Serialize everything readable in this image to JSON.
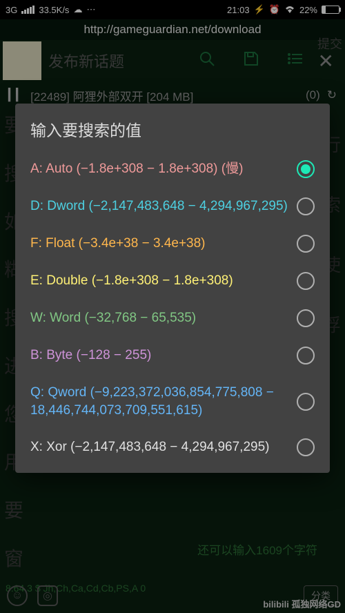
{
  "status": {
    "network": "3G",
    "speed": "33.5K/s",
    "time": "21:03",
    "battery_pct": "22%"
  },
  "url": "http://gameguardian.net/download",
  "bg": {
    "post_title": "发布新话题",
    "submit": "提交",
    "process_line": "[22489] 阿狸外部双开 [204 MB]",
    "process_count": "(0)",
    "left_words": [
      "要",
      "搜",
      "如",
      "糊",
      "搜",
      "进",
      "您",
      "用",
      "要",
      "窗"
    ],
    "right_words": [
      "行",
      "索",
      "使",
      "浮"
    ],
    "remaining": "还可以输入1609个字符",
    "sort": "分类",
    "footer": "8.64.3 $ Jh,Ch,Ca,Cd,Cb,PS,A 0",
    "watermark": "bilibili 孤独网络GD"
  },
  "dialog": {
    "title": "输入要搜索的值",
    "options": [
      {
        "label": "A: Auto (−1.8e+308 − 1.8e+308) (慢)",
        "color": "c-red",
        "selected": true
      },
      {
        "label": "D: Dword (−2,147,483,648 − 4,294,967,295)",
        "color": "c-teal",
        "selected": false
      },
      {
        "label": "F: Float (−3.4e+38 − 3.4e+38)",
        "color": "c-orange",
        "selected": false
      },
      {
        "label": "E: Double (−1.8e+308 − 1.8e+308)",
        "color": "c-yellow",
        "selected": false
      },
      {
        "label": "W: Word (−32,768 − 65,535)",
        "color": "c-green",
        "selected": false
      },
      {
        "label": "B: Byte (−128 − 255)",
        "color": "c-purple",
        "selected": false
      },
      {
        "label": "Q: Qword (−9,223,372,036,854,775,808 − 18,446,744,073,709,551,615)",
        "color": "c-blue",
        "selected": false
      },
      {
        "label": "X: Xor (−2,147,483,648 − 4,294,967,295)",
        "color": "c-grey",
        "selected": false
      }
    ]
  }
}
